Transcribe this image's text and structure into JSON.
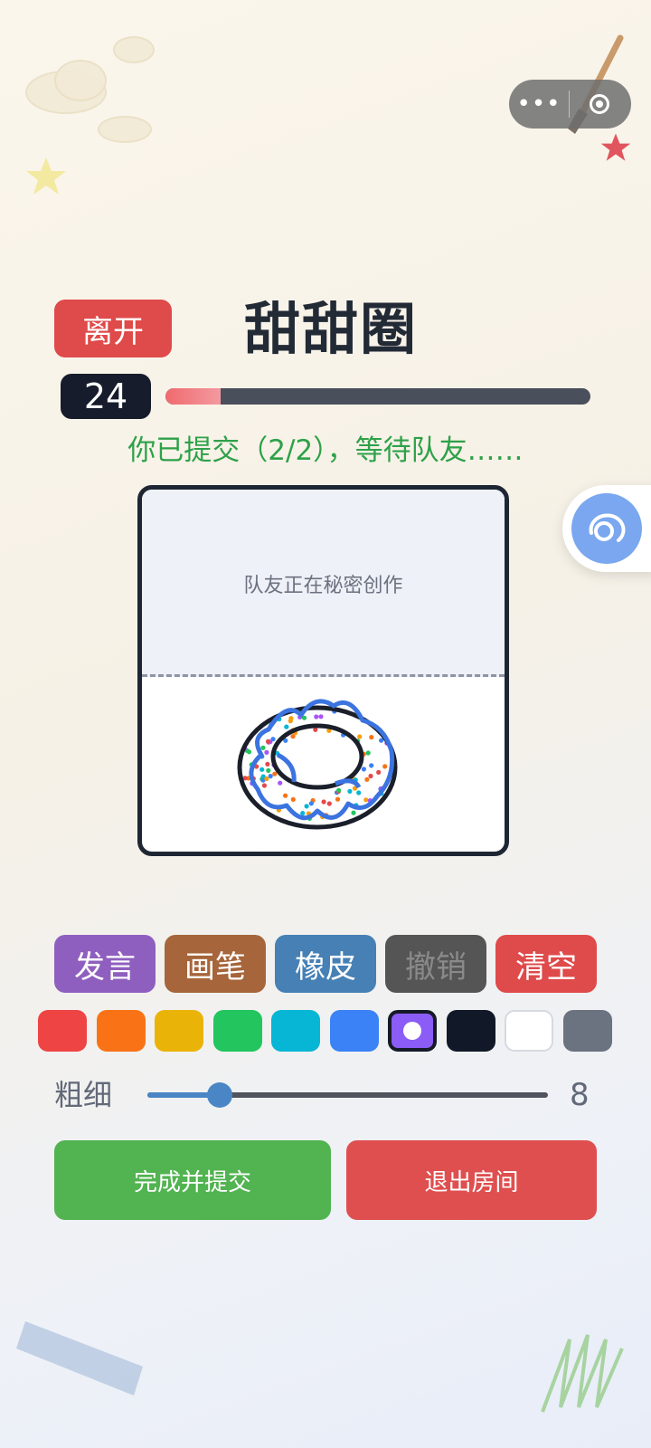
{
  "capsule": {
    "menu_icon": "more-dots-icon",
    "close_icon": "target-circle-icon"
  },
  "header": {
    "leave_label": "离开",
    "word": "甜甜圈"
  },
  "timer": {
    "value": "24",
    "progress": 0.13
  },
  "status": {
    "text": "你已提交（2/2），等待队友……"
  },
  "canvas": {
    "teammate_text": "队友正在秘密创作"
  },
  "float_button": {
    "icon": "chat-bubble-icon",
    "color": "#7aa7ef"
  },
  "tools": [
    {
      "label": "发言",
      "color": "#8f5fbf",
      "text_color": "#ffffff"
    },
    {
      "label": "画笔",
      "color": "#a6653a",
      "text_color": "#ffffff"
    },
    {
      "label": "橡皮",
      "color": "#4680b5",
      "text_color": "#ffffff"
    },
    {
      "label": "撤销",
      "color": "#555555",
      "text_color": "#8a8a8a"
    },
    {
      "label": "清空",
      "color": "#df4a4a",
      "text_color": "#ffffff"
    }
  ],
  "palette": {
    "colors": [
      "#ef4444",
      "#f97316",
      "#eab308",
      "#22c55e",
      "#06b6d4",
      "#3b82f6",
      "#8b5cf6",
      "#111827",
      "#ffffff",
      "#6b7280"
    ],
    "selected_index": 6
  },
  "brush_size": {
    "label": "粗细",
    "value": "8",
    "min": 1,
    "max": 40
  },
  "actions": {
    "submit_label": "完成并提交",
    "submit_color": "#52b351",
    "exit_label": "退出房间",
    "exit_color": "#df4f4f"
  }
}
